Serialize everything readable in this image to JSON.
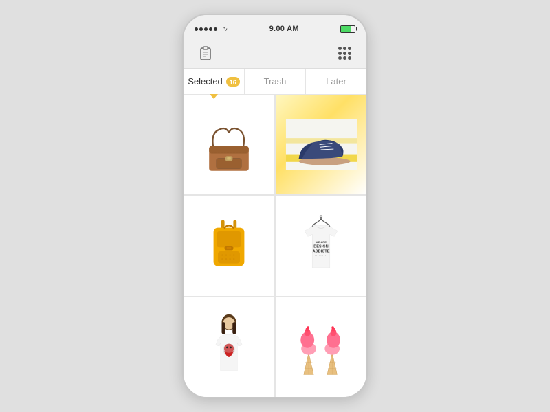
{
  "statusBar": {
    "time": "9.00 AM",
    "signalDots": 5,
    "batteryPercent": 75
  },
  "toolbar": {
    "clipboardIconLabel": "clipboard",
    "gridIconLabel": "grid-menu"
  },
  "tabs": [
    {
      "id": "selected",
      "label": "Selected",
      "badge": "16",
      "active": true
    },
    {
      "id": "trash",
      "label": "Trash",
      "badge": null,
      "active": false
    },
    {
      "id": "later",
      "label": "Later",
      "badge": null,
      "active": false
    }
  ],
  "products": [
    {
      "id": "p1",
      "type": "bag-brown",
      "alt": "Brown leather satchel bag"
    },
    {
      "id": "p2",
      "type": "shoe-blue",
      "alt": "Blue suede oxford shoe"
    },
    {
      "id": "p3",
      "type": "bag-yellow",
      "alt": "Yellow backpack"
    },
    {
      "id": "p4",
      "type": "tshirt-design",
      "alt": "Design Addicted white t-shirt"
    },
    {
      "id": "p5",
      "type": "tshirt-woman",
      "alt": "Woman in graphic t-shirt"
    },
    {
      "id": "p6",
      "type": "icecream",
      "alt": "Pink ice cream cones"
    }
  ]
}
